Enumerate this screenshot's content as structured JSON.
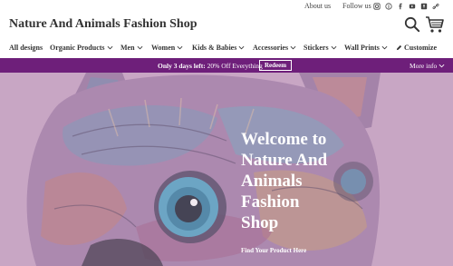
{
  "topbar": {
    "about_label": "About us",
    "follow_label": "Follow us",
    "social_icons": [
      "instagram-icon",
      "pinterest-icon",
      "facebook-icon",
      "youtube-icon",
      "tumblr-icon",
      "link-icon"
    ]
  },
  "header": {
    "shop_title": "Nature And Animals Fashion Shop"
  },
  "nav": {
    "items": [
      {
        "label": "All designs",
        "has_dropdown": false
      },
      {
        "label": "Organic Products",
        "has_dropdown": true
      },
      {
        "label": "Men",
        "has_dropdown": true
      },
      {
        "label": "Women",
        "has_dropdown": true
      },
      {
        "label": "Kids & Babies",
        "has_dropdown": true
      },
      {
        "label": "Accessories",
        "has_dropdown": true
      },
      {
        "label": "Stickers",
        "has_dropdown": true
      },
      {
        "label": "Wall Prints",
        "has_dropdown": true
      },
      {
        "label": "Customize",
        "has_dropdown": false
      }
    ]
  },
  "promo": {
    "prefix": "Only 3 days left:",
    "offer": "20% Off Everything",
    "redeem_label": "Redeem",
    "more_info_label": "More info"
  },
  "hero": {
    "heading": "Welcome to\nNature And\nAnimals\nFashion\nShop",
    "link_label": "Find Your Product Here"
  },
  "colors": {
    "promo_bg": "#6e1f7a",
    "hero_bg": "#c9a6c5"
  }
}
